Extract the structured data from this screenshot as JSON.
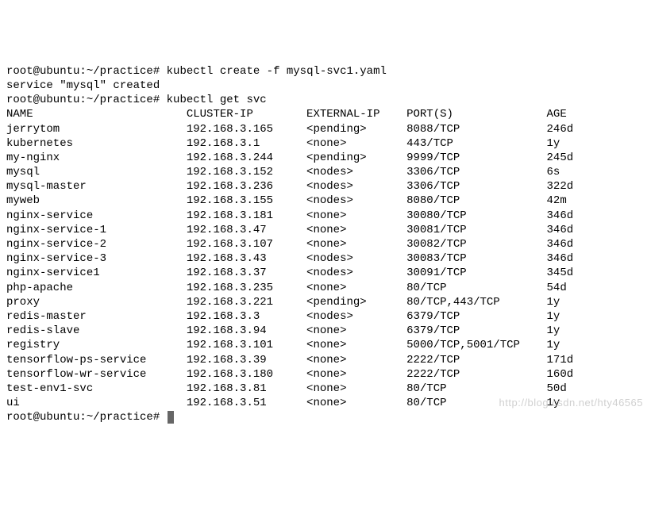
{
  "prompt": "root@ubuntu:~/practice#",
  "cmd1": "kubectl create -f mysql-svc1.yaml",
  "resp1": "service \"mysql\" created",
  "cmd2": "kubectl get svc",
  "headers": {
    "name": "NAME",
    "cip": "CLUSTER-IP",
    "eip": "EXTERNAL-IP",
    "ports": "PORT(S)",
    "age": "AGE"
  },
  "rows": [
    {
      "name": "jerrytom",
      "cip": "192.168.3.165",
      "eip": "<pending>",
      "ports": "8088/TCP",
      "age": "246d"
    },
    {
      "name": "kubernetes",
      "cip": "192.168.3.1",
      "eip": "<none>",
      "ports": "443/TCP",
      "age": "1y"
    },
    {
      "name": "my-nginx",
      "cip": "192.168.3.244",
      "eip": "<pending>",
      "ports": "9999/TCP",
      "age": "245d"
    },
    {
      "name": "mysql",
      "cip": "192.168.3.152",
      "eip": "<nodes>",
      "ports": "3306/TCP",
      "age": "6s"
    },
    {
      "name": "mysql-master",
      "cip": "192.168.3.236",
      "eip": "<nodes>",
      "ports": "3306/TCP",
      "age": "322d"
    },
    {
      "name": "myweb",
      "cip": "192.168.3.155",
      "eip": "<nodes>",
      "ports": "8080/TCP",
      "age": "42m"
    },
    {
      "name": "nginx-service",
      "cip": "192.168.3.181",
      "eip": "<none>",
      "ports": "30080/TCP",
      "age": "346d"
    },
    {
      "name": "nginx-service-1",
      "cip": "192.168.3.47",
      "eip": "<none>",
      "ports": "30081/TCP",
      "age": "346d"
    },
    {
      "name": "nginx-service-2",
      "cip": "192.168.3.107",
      "eip": "<none>",
      "ports": "30082/TCP",
      "age": "346d"
    },
    {
      "name": "nginx-service-3",
      "cip": "192.168.3.43",
      "eip": "<nodes>",
      "ports": "30083/TCP",
      "age": "346d"
    },
    {
      "name": "nginx-service1",
      "cip": "192.168.3.37",
      "eip": "<nodes>",
      "ports": "30091/TCP",
      "age": "345d"
    },
    {
      "name": "php-apache",
      "cip": "192.168.3.235",
      "eip": "<none>",
      "ports": "80/TCP",
      "age": "54d"
    },
    {
      "name": "proxy",
      "cip": "192.168.3.221",
      "eip": "<pending>",
      "ports": "80/TCP,443/TCP",
      "age": "1y"
    },
    {
      "name": "redis-master",
      "cip": "192.168.3.3",
      "eip": "<nodes>",
      "ports": "6379/TCP",
      "age": "1y"
    },
    {
      "name": "redis-slave",
      "cip": "192.168.3.94",
      "eip": "<none>",
      "ports": "6379/TCP",
      "age": "1y"
    },
    {
      "name": "registry",
      "cip": "192.168.3.101",
      "eip": "<none>",
      "ports": "5000/TCP,5001/TCP",
      "age": "1y"
    },
    {
      "name": "tensorflow-ps-service",
      "cip": "192.168.3.39",
      "eip": "<none>",
      "ports": "2222/TCP",
      "age": "171d"
    },
    {
      "name": "tensorflow-wr-service",
      "cip": "192.168.3.180",
      "eip": "<none>",
      "ports": "2222/TCP",
      "age": "160d"
    },
    {
      "name": "test-env1-svc",
      "cip": "192.168.3.81",
      "eip": "<none>",
      "ports": "80/TCP",
      "age": "50d"
    },
    {
      "name": "ui",
      "cip": "192.168.3.51",
      "eip": "<none>",
      "ports": "80/TCP",
      "age": "1y"
    }
  ],
  "watermark": "http://blog.csdn.net/hty46565",
  "cols": {
    "name": 27,
    "cip": 18,
    "eip": 15,
    "ports": 21
  }
}
